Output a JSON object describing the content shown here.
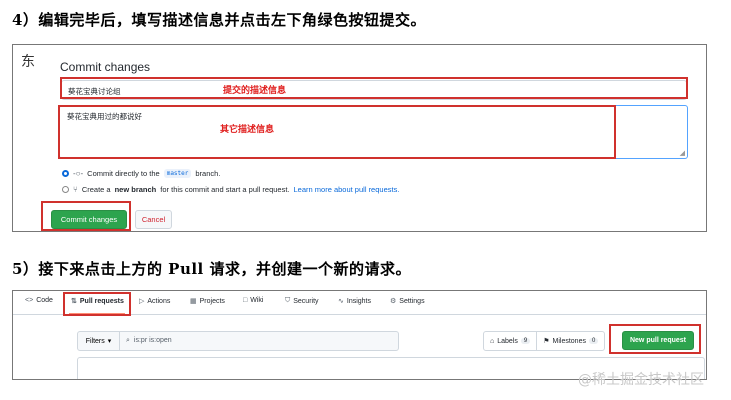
{
  "step4": {
    "heading": "4）编辑完毕后，填写描述信息并点击左下角绿色按钮提交。"
  },
  "step5": {
    "heading": "5）接下来点击上方的 Pull 请求，并创建一个新的请求。"
  },
  "commit_form": {
    "side_char": "东",
    "title": "Commit changes",
    "summary_value": "葵花宝典讨论组",
    "description_value": "葵花宝典用过的都说好",
    "annotation_summary": "提交的描述信息",
    "annotation_description": "其它描述信息",
    "option_direct": {
      "prefix": "Commit directly to the",
      "branch": "master",
      "suffix": "branch.",
      "selected": true
    },
    "option_branch": {
      "prefix": "Create a",
      "bold": "new branch",
      "middle": "for this commit and start a pull request.",
      "link": "Learn more about pull requests.",
      "selected": false
    },
    "commit_button": "Commit changes",
    "cancel_button": "Cancel",
    "colors": {
      "primary_green": "#2da44e",
      "annotation_red": "#d0312d",
      "link_blue": "#0969da"
    }
  },
  "repo_nav": {
    "tabs": [
      {
        "icon": "code-icon",
        "label": "Code"
      },
      {
        "icon": "pull-request-icon",
        "label": "Pull requests",
        "active": true
      },
      {
        "icon": "actions-icon",
        "label": "Actions"
      },
      {
        "icon": "projects-icon",
        "label": "Projects"
      },
      {
        "icon": "wiki-icon",
        "label": "Wiki"
      },
      {
        "icon": "security-icon",
        "label": "Security"
      },
      {
        "icon": "insights-icon",
        "label": "Insights"
      },
      {
        "icon": "settings-icon",
        "label": "Settings"
      }
    ],
    "filters_label": "Filters",
    "search_query": "is:pr is:open",
    "labels_label": "Labels",
    "labels_count": "9",
    "milestones_label": "Milestones",
    "milestones_count": "0",
    "new_pr_button": "New pull request"
  },
  "watermark": "@稀土掘金技术社区"
}
